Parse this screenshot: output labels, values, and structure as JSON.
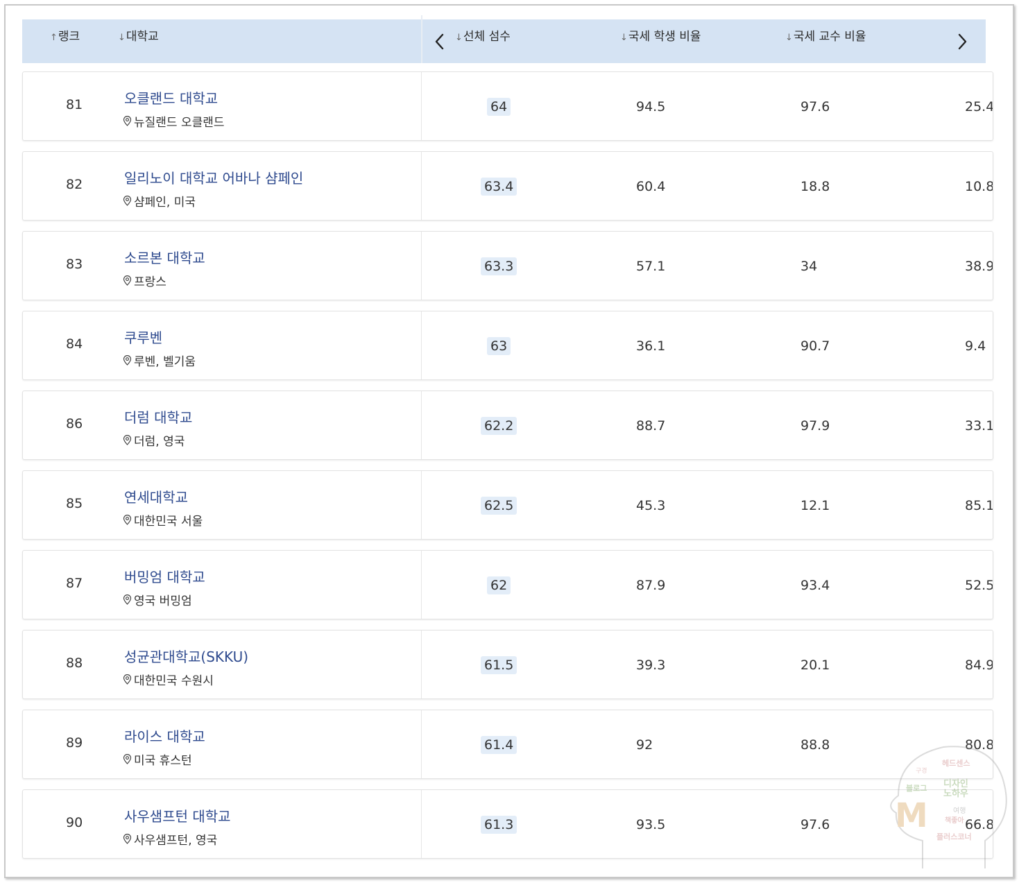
{
  "header": {
    "rank": "랭크",
    "university": "대학교",
    "overall": "선체 섬수",
    "intl_students": "국세 학생 비율",
    "intl_faculty": "국세 교수 비율"
  },
  "rows": [
    {
      "rank": "81",
      "name": "오클랜드 대학교",
      "location": "뉴질랜드 오클랜드",
      "overall": "64",
      "students": "94.5",
      "faculty": "97.6",
      "extra": "25.4"
    },
    {
      "rank": "82",
      "name": "일리노이 대학교 어바나 샴페인",
      "location": "샴페인, 미국",
      "overall": "63.4",
      "students": "60.4",
      "faculty": "18.8",
      "extra": "10.8"
    },
    {
      "rank": "83",
      "name": "소르본 대학교",
      "location": "프랑스",
      "overall": "63.3",
      "students": "57.1",
      "faculty": "34",
      "extra": "38.9"
    },
    {
      "rank": "84",
      "name": "쿠루벤",
      "location": "루벤, 벨기움",
      "overall": "63",
      "students": "36.1",
      "faculty": "90.7",
      "extra": "9.4"
    },
    {
      "rank": "86",
      "name": "더럼 대학교",
      "location": "더럼, 영국",
      "overall": "62.2",
      "students": "88.7",
      "faculty": "97.9",
      "extra": "33.1"
    },
    {
      "rank": "85",
      "name": "연세대학교",
      "location": "대한민국 서울",
      "overall": "62.5",
      "students": "45.3",
      "faculty": "12.1",
      "extra": "85.1"
    },
    {
      "rank": "87",
      "name": "버밍엄 대학교",
      "location": "영국 버밍엄",
      "overall": "62",
      "students": "87.9",
      "faculty": "93.4",
      "extra": "52.5"
    },
    {
      "rank": "88",
      "name": "성균관대학교(SKKU)",
      "location": "대한민국 수원시",
      "overall": "61.5",
      "students": "39.3",
      "faculty": "20.1",
      "extra": "84.9"
    },
    {
      "rank": "89",
      "name": "라이스 대학교",
      "location": "미국 휴스턴",
      "overall": "61.4",
      "students": "92",
      "faculty": "88.8",
      "extra": "80.8"
    },
    {
      "rank": "90",
      "name": "사우샘프턴 대학교",
      "location": "사우샘프턴, 영국",
      "overall": "61.3",
      "students": "93.5",
      "faculty": "97.6",
      "extra": "66.8"
    }
  ],
  "watermark": {
    "letter": "M",
    "words": [
      "헤드센스",
      "디자인",
      "노하우",
      "블로그",
      "여행",
      "책좋아",
      "플러스코너",
      "구경"
    ]
  }
}
